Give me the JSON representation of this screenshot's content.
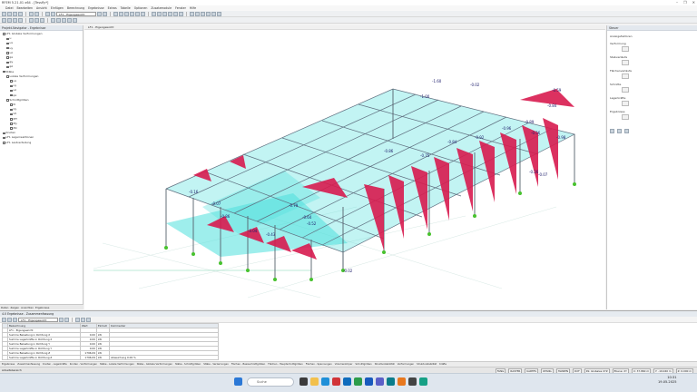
{
  "window": {
    "title": "RFEM 5.21.01 x64 - [Tessfly*]",
    "controls": [
      "–",
      "❐",
      "✕"
    ]
  },
  "menu": [
    "Datei",
    "Bearbeiten",
    "Ansicht",
    "Einfügen",
    "Berechnung",
    "Ergebnisse",
    "Extras",
    "Tabelle",
    "Optionen",
    "Zusatzmodule",
    "Fenster",
    "Hilfe"
  ],
  "toolbar": {
    "loadcase": "LF1 - Eigengewicht",
    "results_loadcase": "LF1 - Eigengewicht"
  },
  "navigator": {
    "title": "Projekt-Navigator - Ergebnisse",
    "tree": [
      "LF1 Globale Verformungen",
      "u",
      "ux",
      "uy",
      "uz",
      "φx",
      "φy",
      "φz",
      "Stäbe",
      "Lokale Verformungen",
      "ux",
      "uy",
      "uz",
      "φx",
      "Schnittgrößen",
      "N",
      "Vy",
      "Vz",
      "MT",
      "My",
      "Mz",
      "Knoten",
      "LF1 Lagerreaktionen",
      "LF1 Lastverteilung"
    ],
    "tabs": [
      "Daten",
      "Zeigen",
      "Ansichten",
      "Ergebnisse"
    ]
  },
  "viewport": {
    "tab": "LF1 - Eigengewicht"
  },
  "labels": [
    "-1.60",
    "-0.02",
    "-0.59",
    "-1.00",
    "-0.84",
    "-0.86",
    "-0.96",
    "-0.89",
    "-0.84",
    "-0.75",
    "-0.98",
    "-0.56",
    "-0.92",
    "-0.16",
    "-0.86",
    "-0.79",
    "-0.64",
    "-0.26",
    "-0.02",
    "-0.07",
    "-0.04",
    "-0.43",
    "-0.52",
    "-0.07"
  ],
  "properties": {
    "title": "Steuer",
    "fields": [
      "Anzeigefaktoren",
      "Verformung",
      "Stabverläufe",
      "Flächenverläufe",
      "Schnitte",
      "Lagerkräfte",
      "Ergebnisse"
    ]
  },
  "results": {
    "title": "4.0 Ergebnisse - Zusammenfassung",
    "loadcase": "LF1 - Eigengewicht",
    "columns": [
      "",
      "Bezeichnung",
      "Wert",
      "Einheit",
      "Kommentar"
    ],
    "rows": [
      [
        "",
        "LF1 - Eigengewicht",
        "",
        "",
        ""
      ],
      [
        "",
        "Summe Belastung in Richtung X",
        "0.00",
        "kN",
        ""
      ],
      [
        "",
        "Summe Lagerkräfte in Richtung X",
        "0.00",
        "kN",
        ""
      ],
      [
        "",
        "Summe Belastung in Richtung Y",
        "0.00",
        "kN",
        ""
      ],
      [
        "",
        "Summe Lagerkräfte in Richtung Y",
        "0.00",
        "kN",
        ""
      ],
      [
        "",
        "Summe Belastung in Richtung Z",
        "1796.09",
        "kN",
        ""
      ],
      [
        "",
        "Summe Lagerkräfte in Richtung Z",
        "1796.09",
        "kN",
        "Abweichung 0.00 %"
      ]
    ],
    "tabs": [
      "Ergebnisse",
      "Zusammenfassung",
      "Knoten - Lagerkräfte",
      "Knoten - Verformungen",
      "Stäbe - Lokale Verformungen",
      "Stäbe - Globale Verformungen",
      "Stäbe - Schnittgrößen",
      "Stäbe - Verzerrungen",
      "Flächen - Basisschnittgrößen",
      "Flächen - Hauptschnittgrößen",
      "Flächen - Spannungen",
      "Volumenkörper",
      "Schnittgrößen",
      "Strukturstabilität",
      "Verformungen",
      "Strukturstabilität",
      "Kräfte"
    ]
  },
  "status": {
    "message": "Arbeitsbereich",
    "fields": [
      "FANG",
      "RASTER",
      "KARTES",
      "OFANG",
      "HLINIEN",
      "DXF",
      "KS: Globales XYZ",
      "Ebene: XY",
      "X: 37.860 m",
      "Y: -19.040 m",
      "Z: 0.000 m"
    ]
  },
  "taskbar": {
    "search": "Suche",
    "time": "10:31",
    "date": "19.05.2025"
  },
  "colors": {
    "cyan": "#4fe0dc",
    "crimson": "#d81b4f",
    "frame": "#607080",
    "support": "#47c22e"
  }
}
